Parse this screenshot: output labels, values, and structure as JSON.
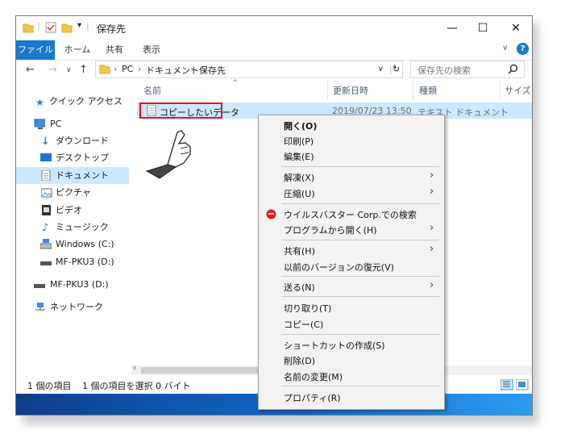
{
  "window": {
    "title": "保存先",
    "controls": {
      "minimize": "—",
      "maximize": "☐",
      "close": "✕"
    }
  },
  "ribbon": {
    "tabs": [
      "ファイル",
      "ホーム",
      "共有",
      "表示"
    ]
  },
  "address": {
    "crumbs": [
      "PC",
      "ドキュメント",
      "保存先"
    ],
    "search_placeholder": "保存先の検索"
  },
  "nav_pane": {
    "items": [
      {
        "label": "クイック アクセス",
        "icon": "star-icon"
      },
      {
        "label": "PC",
        "icon": "pc-icon"
      },
      {
        "label": "ダウンロード",
        "icon": "download-icon"
      },
      {
        "label": "デスクトップ",
        "icon": "desktop-icon"
      },
      {
        "label": "ドキュメント",
        "icon": "document-icon",
        "selected": true
      },
      {
        "label": "ピクチャ",
        "icon": "picture-icon"
      },
      {
        "label": "ビデオ",
        "icon": "video-icon"
      },
      {
        "label": "ミュージック",
        "icon": "music-icon"
      },
      {
        "label": "Windows (C:)",
        "icon": "drive-icon"
      },
      {
        "label": "MF-PKU3 (D:)",
        "icon": "usb-drive-icon"
      },
      {
        "label": "MF-PKU3 (D:)",
        "icon": "usb-drive-icon"
      },
      {
        "label": "ネットワーク",
        "icon": "network-icon"
      }
    ]
  },
  "columns": [
    "名前",
    "更新日時",
    "種類",
    "サイズ"
  ],
  "file": {
    "name": "コピーしたいデータ",
    "modified": "2019/07/23 13:50",
    "type": "テキスト ドキュメント"
  },
  "status": {
    "count": "1 個の項目",
    "selection": "1 個の項目を選択  0 バイト"
  },
  "context_menu": {
    "items": [
      "開く(O)",
      "印刷(P)",
      "編集(E)",
      "解凍(X)",
      "圧縮(U)",
      "ウイルスバスター Corp.での検索",
      "プログラムから開く(H)",
      "共有(H)",
      "以前のバージョンの復元(V)",
      "送る(N)",
      "切り取り(T)",
      "コピー(C)",
      "ショートカットの作成(S)",
      "削除(D)",
      "名前の変更(M)",
      "プロパティ(R)"
    ]
  },
  "colors": {
    "accent": "#1979ca",
    "selection": "#cce8ff",
    "highlight_box": "#e0141e"
  }
}
